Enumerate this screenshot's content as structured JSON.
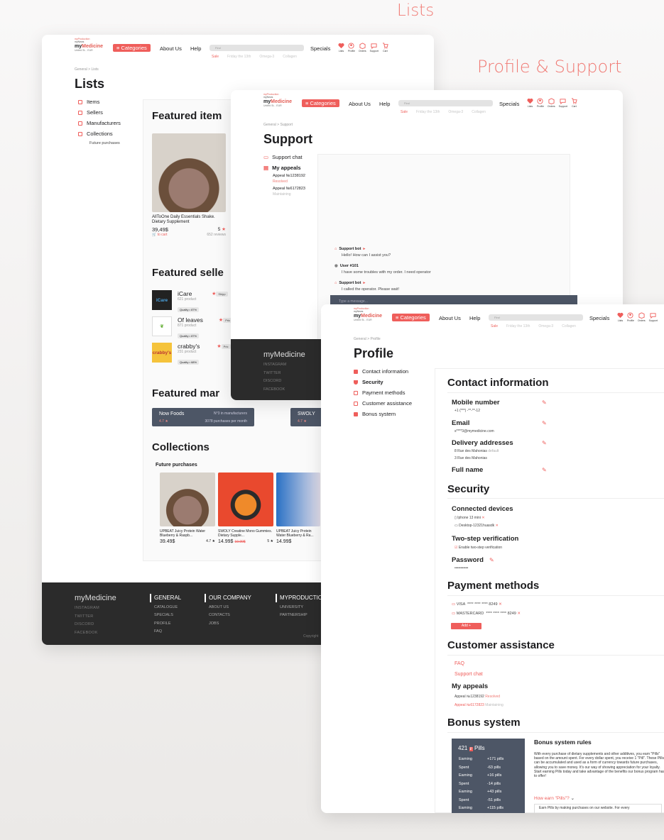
{
  "titles": {
    "lists": "Lists",
    "profile_support": "Profile & Support"
  },
  "header": {
    "brand_top": "myProduction",
    "brand_mid": "myNews",
    "brand_my": "my",
    "brand_name": "Medicine",
    "location": "United St...  EUR",
    "categories": "Categories",
    "about": "About Us",
    "help": "Help",
    "search_placeholder": "Find",
    "specials": "Specials",
    "subnav": [
      "Sale",
      "Friday the 13th",
      "Omega-3",
      "Collagen"
    ],
    "icons": [
      "Lists",
      "Profile",
      "Orders",
      "Support",
      "Cart"
    ]
  },
  "lists": {
    "breadcrumb": "General   >   Lists",
    "title": "Lists",
    "sidebar": [
      "Items",
      "Sellers",
      "Manufacturers",
      "Collections"
    ],
    "sidebar_sub": "Future purchases",
    "featured_items": "Featured item",
    "item": {
      "name": "AllToOne Daily Essentials Shake. Dietary Supplement",
      "price": "39,49$",
      "rating": "5",
      "cart": "to cart",
      "reviews": "652 reviews"
    },
    "featured_sellers": "Featured selle",
    "sellers": [
      {
        "logo": "iCare",
        "name": "iCare",
        "products": "621 product",
        "quality": "Quality • 87%",
        "tag": "Shipp"
      },
      {
        "logo": "",
        "name": "Of leaves",
        "products": "871 product",
        "quality": "Quality • 87%",
        "tag": "Pric"
      },
      {
        "logo": "crabby's",
        "name": "crabby's",
        "products": "231 product",
        "quality": "Quality • 68%",
        "tag": "Pric"
      }
    ],
    "featured_manufacturers": "Featured mar",
    "manufacturers": [
      {
        "name": "Now Foods",
        "rating": "4.7 ★",
        "rank": "N°3 in manufacturers",
        "purchases": "3078 purchases per month"
      },
      {
        "name": "SWOLY",
        "rating": "4.7 ★"
      }
    ],
    "collections": "Collections",
    "collection_name": "Future purchases",
    "collection_items": [
      {
        "name": "UPBEAT Juicy Protein Water Blueberry & Raspb...",
        "price": "39.49$",
        "rating": "4.7 ★",
        "old": ""
      },
      {
        "name": "SWOLY Creatine Mono Gummies. Dietary Supple...",
        "price": "14.99$",
        "rating": "5 ★",
        "old": "19.99$"
      },
      {
        "name": "UPBEAT Juicy Protein Water Blueberry & Ra...",
        "price": "14.99$",
        "rating": "",
        "old": ""
      }
    ],
    "footer": {
      "brand": "myMedicine",
      "social": [
        "INSTAGRAM",
        "TWITTER",
        "DISCORD",
        "FACEBOOK"
      ],
      "general": {
        "title": "GENERAL",
        "items": [
          "CATALOGUE",
          "SPECIALS",
          "PROFILE",
          "FAQ"
        ]
      },
      "company": {
        "title": "OUR COMPANY",
        "items": [
          "ABOUT US",
          "CONTACTS",
          "JOBS"
        ]
      },
      "production": {
        "title": "MYPRODUCTIO",
        "items": [
          "UNIVERSITY",
          "PARTNERSHIP"
        ]
      },
      "copyright": "Copyright"
    }
  },
  "support": {
    "breadcrumb": "General   >   Support",
    "title": "Support",
    "chat_link": "Support chat",
    "appeals_title": "My appeals",
    "appeals": [
      {
        "id": "Appeal №1238192",
        "status": "Resolved"
      },
      {
        "id": "Appeal №6172823",
        "status": "Maintaining"
      }
    ],
    "messages": [
      {
        "who": "Support bot",
        "text": "Hello! How can I assist you?"
      },
      {
        "who": "User #101",
        "text": "I have some troubles with my order. I need operator"
      },
      {
        "who": "Support bot",
        "text": "I called the operator. Please wait!"
      }
    ],
    "input_placeholder": "Type a message...",
    "footer_brand": "myMedicine",
    "footer_social": [
      "INSTAGRAM",
      "TWITTER",
      "DISCORD",
      "FACEBOOK"
    ]
  },
  "profile": {
    "breadcrumb": "General   >   Profile",
    "title": "Profile",
    "sidebar": [
      "Contact information",
      "Security",
      "Payment methods",
      "Customer assistance",
      "Bonus system"
    ],
    "contact_title": "Contact information",
    "mobile_label": "Mobile number",
    "mobile_value": "+1 (***) -**-**-12",
    "email_label": "Email",
    "email_value": "s****3@mymedicine.com",
    "address_label": "Delivery addresses",
    "address1": "8 Rue des Mahonias",
    "address_default": "default",
    "address2": "3 Rue des Mahonias",
    "fullname_label": "Full name",
    "security_title": "Security",
    "devices_label": "Connected devices",
    "device1": "Iphone 13 mini",
    "device2": "Desktop-12321huasdk",
    "twostep_label": "Two-step verification",
    "twostep_value": "Enable two-step verification",
    "password_label": "Password",
    "password_value": "•••••••••••",
    "payment_title": "Payment methods",
    "cards": [
      {
        "type": "VISA",
        "num": "**** **** **** 8249"
      },
      {
        "type": "MASTERCARD",
        "num": "**** **** **** 8249"
      }
    ],
    "add_btn": "Add +",
    "assist_title": "Customer assistance",
    "faq": "FAQ",
    "support_chat": "Support chat",
    "my_appeals": "My appeals",
    "appeal1": "Appeal №1238192",
    "appeal1_status": "Resolved",
    "appeal2": "Appeal №6172823",
    "appeal2_status": "Maintaining",
    "bonus_title": "Bonus system",
    "pills_count": "421",
    "pills_label": "Pills",
    "ledger": [
      {
        "type": "Earning",
        "val": "+171 pills"
      },
      {
        "type": "Spent",
        "val": "-63 pills"
      },
      {
        "type": "Earning",
        "val": "+16 pills"
      },
      {
        "type": "Spent",
        "val": "-14 pills"
      },
      {
        "type": "Earning",
        "val": "+43 pills"
      },
      {
        "type": "Spent",
        "val": "-51 pills"
      },
      {
        "type": "Earning",
        "val": "+115 pills"
      }
    ],
    "rules_title": "Bonus system rules",
    "rules_text": "With every purchase of dietary supplements and other additives, you earn \"Pills\" based on the amount spent. For every dollar spent, you receive 1 \"Pill\". These Pills can be accumulated and used as a form of currency towards future purchases, allowing you to save money. It's our way of showing appreciation for your loyalty. Start earning Pills today and take advantage of the benefits our bonus program has to offer!",
    "how_earn": "How earn \"Pills\"?",
    "how_text": "Earn Pills by making purchases on our website. For every"
  }
}
